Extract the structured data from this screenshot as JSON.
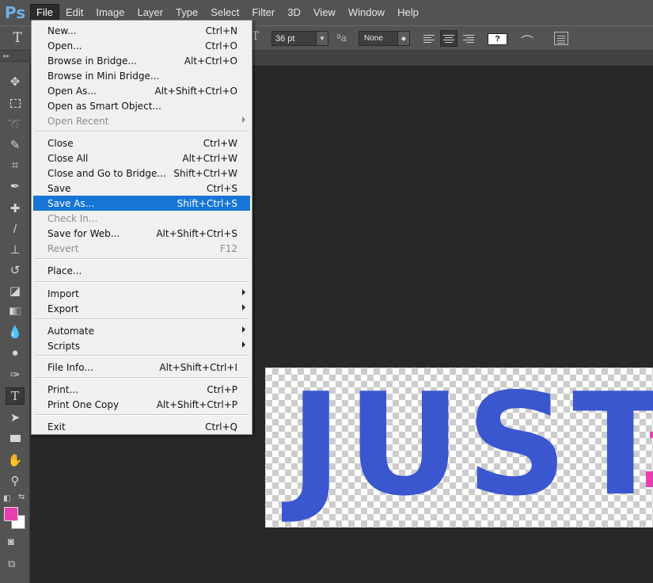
{
  "app": {
    "logo": "Ps"
  },
  "menubar": {
    "items": [
      "File",
      "Edit",
      "Image",
      "Layer",
      "Type",
      "Select",
      "Filter",
      "3D",
      "View",
      "Window",
      "Help"
    ],
    "active": "File"
  },
  "options": {
    "font_size": "36 pt",
    "antialias": "None",
    "color_swatch_label": "?"
  },
  "file_menu": {
    "groups": [
      [
        {
          "label": "New...",
          "shortcut": "Ctrl+N"
        },
        {
          "label": "Open...",
          "shortcut": "Ctrl+O"
        },
        {
          "label": "Browse in Bridge...",
          "shortcut": "Alt+Ctrl+O"
        },
        {
          "label": "Browse in Mini Bridge...",
          "shortcut": ""
        },
        {
          "label": "Open As...",
          "shortcut": "Alt+Shift+Ctrl+O"
        },
        {
          "label": "Open as Smart Object...",
          "shortcut": ""
        },
        {
          "label": "Open Recent",
          "shortcut": "",
          "submenu": true,
          "disabled": true
        }
      ],
      [
        {
          "label": "Close",
          "shortcut": "Ctrl+W"
        },
        {
          "label": "Close All",
          "shortcut": "Alt+Ctrl+W"
        },
        {
          "label": "Close and Go to Bridge...",
          "shortcut": "Shift+Ctrl+W"
        },
        {
          "label": "Save",
          "shortcut": "Ctrl+S"
        },
        {
          "label": "Save As...",
          "shortcut": "Shift+Ctrl+S",
          "highlighted": true
        },
        {
          "label": "Check In...",
          "shortcut": "",
          "disabled": true
        },
        {
          "label": "Save for Web...",
          "shortcut": "Alt+Shift+Ctrl+S"
        },
        {
          "label": "Revert",
          "shortcut": "F12",
          "disabled": true
        }
      ],
      [
        {
          "label": "Place...",
          "shortcut": ""
        }
      ],
      [
        {
          "label": "Import",
          "shortcut": "",
          "submenu": true
        },
        {
          "label": "Export",
          "shortcut": "",
          "submenu": true
        }
      ],
      [
        {
          "label": "Automate",
          "shortcut": "",
          "submenu": true
        },
        {
          "label": "Scripts",
          "shortcut": "",
          "submenu": true
        }
      ],
      [
        {
          "label": "File Info...",
          "shortcut": "Alt+Shift+Ctrl+I"
        }
      ],
      [
        {
          "label": "Print...",
          "shortcut": "Ctrl+P"
        },
        {
          "label": "Print One Copy",
          "shortcut": "Alt+Shift+Ctrl+P"
        }
      ],
      [
        {
          "label": "Exit",
          "shortcut": "Ctrl+Q"
        }
      ]
    ]
  },
  "tools": [
    "move-tool",
    "marquee-tool",
    "lasso-tool",
    "quick-selection-tool",
    "crop-tool",
    "eyedropper-tool",
    "healing-brush-tool",
    "brush-tool",
    "clone-stamp-tool",
    "history-brush-tool",
    "eraser-tool",
    "gradient-tool",
    "blur-tool",
    "dodge-tool",
    "pen-tool",
    "type-tool",
    "path-selection-tool",
    "rectangle-tool",
    "hand-tool",
    "zoom-tool"
  ],
  "colors": {
    "foreground": "#e83fb1",
    "background": "#ffffff",
    "text_blue": "#3a57d0",
    "text_pink": "#e83fb1",
    "menu_highlight": "#1775d6"
  },
  "document": {
    "text": "JUST"
  }
}
